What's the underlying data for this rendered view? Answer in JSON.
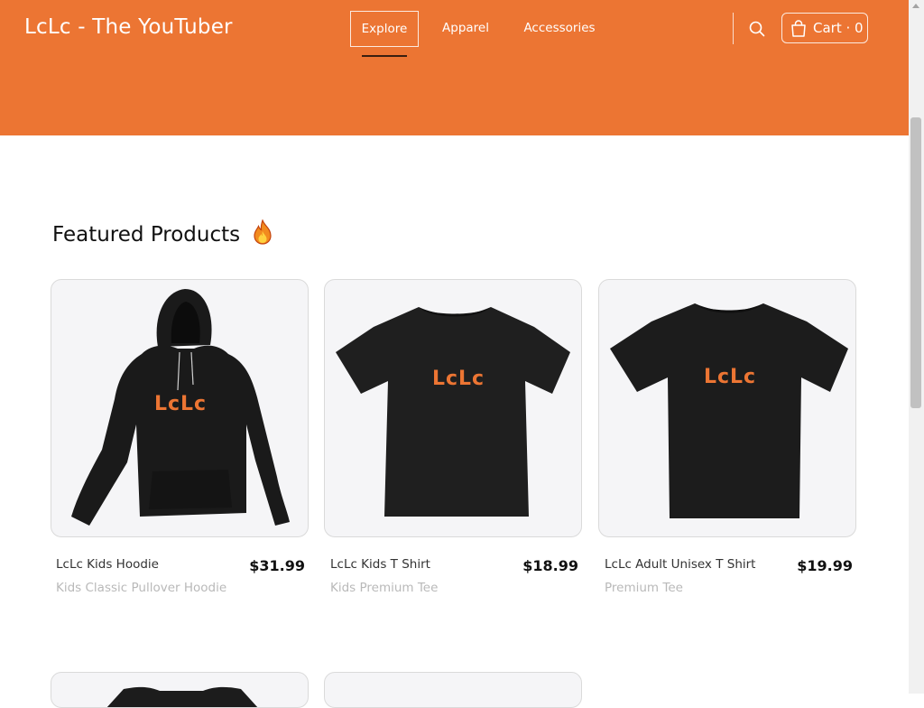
{
  "header": {
    "brand": "LcLc - The YouTuber",
    "background_color": "#ec7533",
    "nav": [
      {
        "label": "Explore",
        "active": true
      },
      {
        "label": "Apparel",
        "active": false
      },
      {
        "label": "Accessories",
        "active": false
      }
    ],
    "search_icon": "search-icon",
    "cart": {
      "label": "Cart · 0",
      "icon": "shopping-bag-icon"
    }
  },
  "featured": {
    "title": "Featured Products",
    "title_emoji": "fire-icon",
    "products": [
      {
        "name": "LcLc Kids Hoodie",
        "subtitle": "Kids Classic Pullover Hoodie",
        "price": "$31.99",
        "image": "black-hoodie",
        "logo": "LcLc"
      },
      {
        "name": "LcLc Kids T Shirt",
        "subtitle": "Kids Premium Tee",
        "price": "$18.99",
        "image": "black-tshirt",
        "logo": "LcLc"
      },
      {
        "name": "LcLc Adult Unisex T Shirt",
        "subtitle": "Premium Tee",
        "price": "$19.99",
        "image": "black-tshirt",
        "logo": "LcLc"
      }
    ]
  }
}
